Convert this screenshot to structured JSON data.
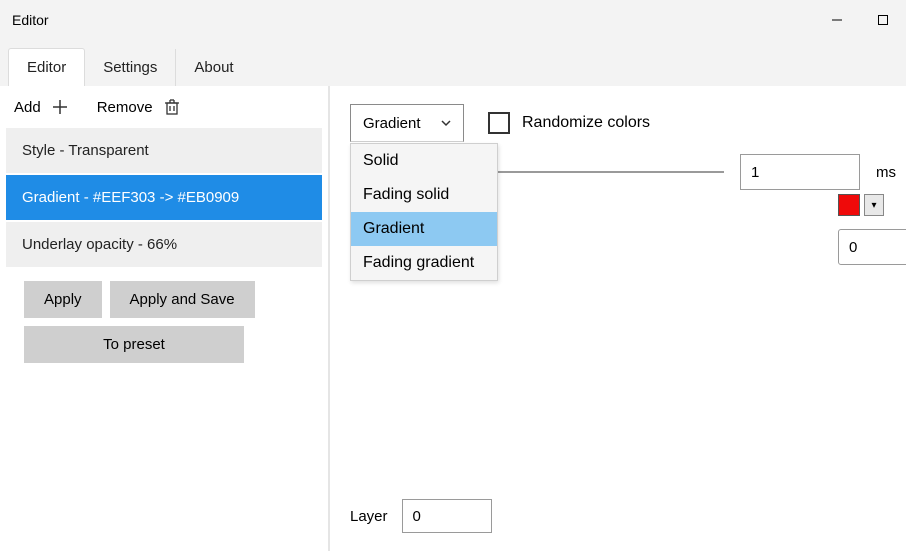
{
  "window": {
    "title": "Editor"
  },
  "tabs": [
    {
      "label": "Editor",
      "active": true
    },
    {
      "label": "Settings",
      "active": false
    },
    {
      "label": "About",
      "active": false
    }
  ],
  "left": {
    "add_label": "Add",
    "remove_label": "Remove",
    "items": [
      {
        "label": "Style - Transparent",
        "selected": false
      },
      {
        "label": "Gradient - #EEF303 -> #EB0909",
        "selected": true
      },
      {
        "label": "Underlay opacity - 66%",
        "selected": false
      }
    ],
    "apply_label": "Apply",
    "apply_save_label": "Apply and Save",
    "to_preset_label": "To preset"
  },
  "right": {
    "type_select": {
      "value": "Gradient",
      "options": [
        "Solid",
        "Fading solid",
        "Gradient",
        "Fading gradient"
      ],
      "highlighted": "Gradient"
    },
    "randomize_label": "Randomize colors",
    "randomize_checked": false,
    "ms_value": "1",
    "ms_unit": "ms",
    "color_swatch": "#EF0A0A",
    "number_value": "0",
    "layer_label": "Layer",
    "layer_value": "0"
  }
}
